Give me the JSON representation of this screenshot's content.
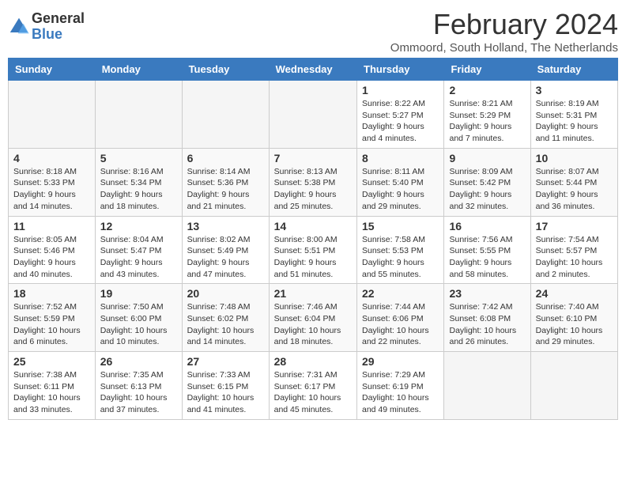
{
  "logo": {
    "general": "General",
    "blue": "Blue"
  },
  "title": "February 2024",
  "subtitle": "Ommoord, South Holland, The Netherlands",
  "weekdays": [
    "Sunday",
    "Monday",
    "Tuesday",
    "Wednesday",
    "Thursday",
    "Friday",
    "Saturday"
  ],
  "weeks": [
    [
      {
        "day": "",
        "info": ""
      },
      {
        "day": "",
        "info": ""
      },
      {
        "day": "",
        "info": ""
      },
      {
        "day": "",
        "info": ""
      },
      {
        "day": "1",
        "info": "Sunrise: 8:22 AM\nSunset: 5:27 PM\nDaylight: 9 hours and 4 minutes."
      },
      {
        "day": "2",
        "info": "Sunrise: 8:21 AM\nSunset: 5:29 PM\nDaylight: 9 hours and 7 minutes."
      },
      {
        "day": "3",
        "info": "Sunrise: 8:19 AM\nSunset: 5:31 PM\nDaylight: 9 hours and 11 minutes."
      }
    ],
    [
      {
        "day": "4",
        "info": "Sunrise: 8:18 AM\nSunset: 5:33 PM\nDaylight: 9 hours and 14 minutes."
      },
      {
        "day": "5",
        "info": "Sunrise: 8:16 AM\nSunset: 5:34 PM\nDaylight: 9 hours and 18 minutes."
      },
      {
        "day": "6",
        "info": "Sunrise: 8:14 AM\nSunset: 5:36 PM\nDaylight: 9 hours and 21 minutes."
      },
      {
        "day": "7",
        "info": "Sunrise: 8:13 AM\nSunset: 5:38 PM\nDaylight: 9 hours and 25 minutes."
      },
      {
        "day": "8",
        "info": "Sunrise: 8:11 AM\nSunset: 5:40 PM\nDaylight: 9 hours and 29 minutes."
      },
      {
        "day": "9",
        "info": "Sunrise: 8:09 AM\nSunset: 5:42 PM\nDaylight: 9 hours and 32 minutes."
      },
      {
        "day": "10",
        "info": "Sunrise: 8:07 AM\nSunset: 5:44 PM\nDaylight: 9 hours and 36 minutes."
      }
    ],
    [
      {
        "day": "11",
        "info": "Sunrise: 8:05 AM\nSunset: 5:46 PM\nDaylight: 9 hours and 40 minutes."
      },
      {
        "day": "12",
        "info": "Sunrise: 8:04 AM\nSunset: 5:47 PM\nDaylight: 9 hours and 43 minutes."
      },
      {
        "day": "13",
        "info": "Sunrise: 8:02 AM\nSunset: 5:49 PM\nDaylight: 9 hours and 47 minutes."
      },
      {
        "day": "14",
        "info": "Sunrise: 8:00 AM\nSunset: 5:51 PM\nDaylight: 9 hours and 51 minutes."
      },
      {
        "day": "15",
        "info": "Sunrise: 7:58 AM\nSunset: 5:53 PM\nDaylight: 9 hours and 55 minutes."
      },
      {
        "day": "16",
        "info": "Sunrise: 7:56 AM\nSunset: 5:55 PM\nDaylight: 9 hours and 58 minutes."
      },
      {
        "day": "17",
        "info": "Sunrise: 7:54 AM\nSunset: 5:57 PM\nDaylight: 10 hours and 2 minutes."
      }
    ],
    [
      {
        "day": "18",
        "info": "Sunrise: 7:52 AM\nSunset: 5:59 PM\nDaylight: 10 hours and 6 minutes."
      },
      {
        "day": "19",
        "info": "Sunrise: 7:50 AM\nSunset: 6:00 PM\nDaylight: 10 hours and 10 minutes."
      },
      {
        "day": "20",
        "info": "Sunrise: 7:48 AM\nSunset: 6:02 PM\nDaylight: 10 hours and 14 minutes."
      },
      {
        "day": "21",
        "info": "Sunrise: 7:46 AM\nSunset: 6:04 PM\nDaylight: 10 hours and 18 minutes."
      },
      {
        "day": "22",
        "info": "Sunrise: 7:44 AM\nSunset: 6:06 PM\nDaylight: 10 hours and 22 minutes."
      },
      {
        "day": "23",
        "info": "Sunrise: 7:42 AM\nSunset: 6:08 PM\nDaylight: 10 hours and 26 minutes."
      },
      {
        "day": "24",
        "info": "Sunrise: 7:40 AM\nSunset: 6:10 PM\nDaylight: 10 hours and 29 minutes."
      }
    ],
    [
      {
        "day": "25",
        "info": "Sunrise: 7:38 AM\nSunset: 6:11 PM\nDaylight: 10 hours and 33 minutes."
      },
      {
        "day": "26",
        "info": "Sunrise: 7:35 AM\nSunset: 6:13 PM\nDaylight: 10 hours and 37 minutes."
      },
      {
        "day": "27",
        "info": "Sunrise: 7:33 AM\nSunset: 6:15 PM\nDaylight: 10 hours and 41 minutes."
      },
      {
        "day": "28",
        "info": "Sunrise: 7:31 AM\nSunset: 6:17 PM\nDaylight: 10 hours and 45 minutes."
      },
      {
        "day": "29",
        "info": "Sunrise: 7:29 AM\nSunset: 6:19 PM\nDaylight: 10 hours and 49 minutes."
      },
      {
        "day": "",
        "info": ""
      },
      {
        "day": "",
        "info": ""
      }
    ]
  ]
}
